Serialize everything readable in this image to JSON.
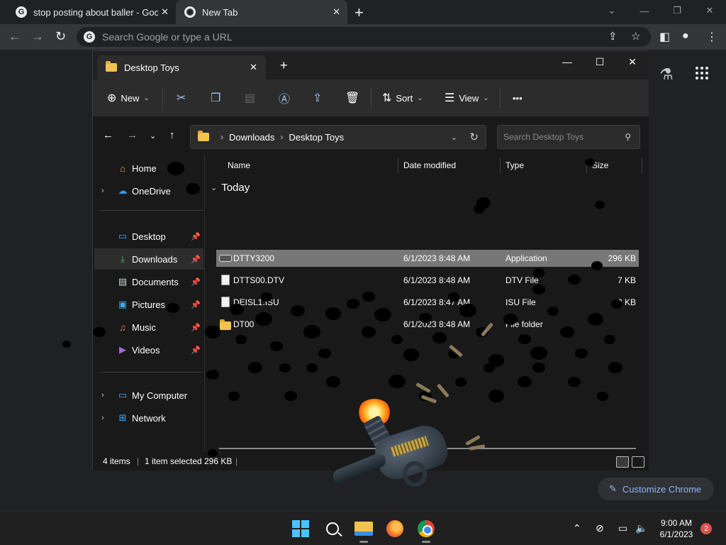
{
  "chrome": {
    "tabs": [
      {
        "title": "stop posting about baller - Goog",
        "icon": "google-g-icon",
        "close": "✕"
      },
      {
        "title": "New Tab",
        "icon": "chrome-icon",
        "close": "✕"
      }
    ],
    "new_tab": "+",
    "omnibox_placeholder": "Search Google or type a URL",
    "customize_label": "Customize Chrome"
  },
  "explorer": {
    "tab_title": "Desktop Toys",
    "toolbar": {
      "new_label": "New",
      "sort_label": "Sort",
      "view_label": "View",
      "more_label": "•••"
    },
    "breadcrumb": [
      "Downloads",
      "Desktop Toys"
    ],
    "search_placeholder": "Search Desktop Toys",
    "nav": {
      "home": "Home",
      "onedrive": "OneDrive",
      "desktop": "Desktop",
      "downloads": "Downloads",
      "documents": "Documents",
      "pictures": "Pictures",
      "music": "Music",
      "videos": "Videos",
      "my_computer": "My Computer",
      "network": "Network"
    },
    "columns": {
      "name": "Name",
      "date": "Date modified",
      "type": "Type",
      "size": "Size"
    },
    "group": "Today",
    "files": [
      {
        "name": "DTTY3200",
        "date": "6/1/2023 8:48 AM",
        "type": "Application",
        "size": "296 KB",
        "icon": "application-icon",
        "selected": true
      },
      {
        "name": "DTTS00.DTV",
        "date": "6/1/2023 8:48 AM",
        "type": "DTV File",
        "size": "7 KB",
        "icon": "file-icon",
        "selected": false
      },
      {
        "name": "DEISL1.ISU",
        "date": "6/1/2023 8:47 AM",
        "type": "ISU File",
        "size": "9 KB",
        "icon": "file-icon",
        "selected": false
      },
      {
        "name": "DT00",
        "date": "6/1/2023 8:48 AM",
        "type": "File folder",
        "size": "",
        "icon": "folder-icon",
        "selected": false
      }
    ],
    "status": {
      "items": "4 items",
      "selected": "1 item selected",
      "size": "296 KB"
    }
  },
  "taskbar": {
    "time": "9:00 AM",
    "date": "6/1/2023",
    "notifications": "2"
  },
  "colors": {
    "accent": "#4cc2ff",
    "selection": "#777777",
    "chrome_link": "#8ab4f8"
  }
}
